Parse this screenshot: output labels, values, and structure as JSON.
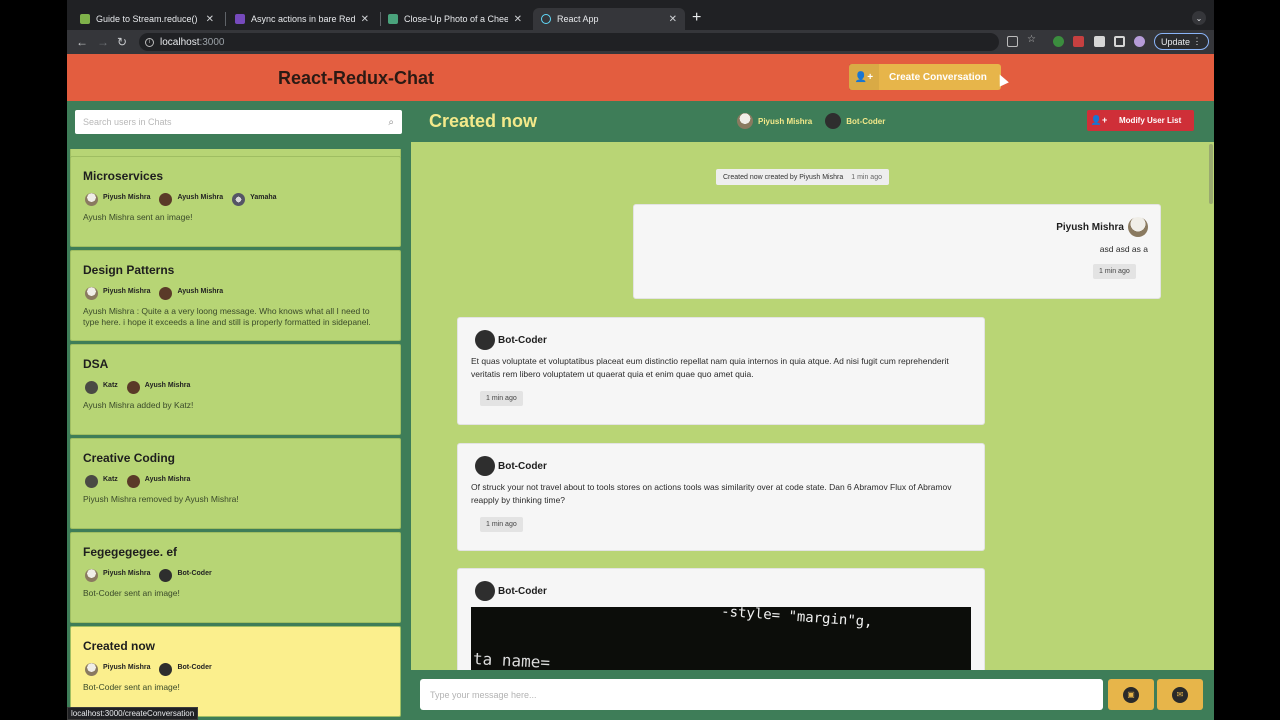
{
  "browser": {
    "tabs": [
      {
        "title": "Guide to Stream.reduce() | Bae",
        "favicon_color": "#7fb24a"
      },
      {
        "title": "Async actions in bare Redux w",
        "favicon_color": "#764abc"
      },
      {
        "title": "Close-Up Photo of a Cheese B",
        "favicon_color": "#4aa37c"
      },
      {
        "title": "React App",
        "favicon_color": "#61dafb"
      }
    ],
    "url_host": "localhost",
    "url_port": ":3000",
    "update_label": "Update",
    "status_url": "localhost:3000/createConversation"
  },
  "app": {
    "title": "React-Redux-Chat",
    "create_label": "Create Conversation",
    "search_placeholder": "Search users in Chats",
    "colors": {
      "header": "#e35d3f",
      "green": "#3e7d58",
      "card": "#b7d575",
      "selected": "#fbef8d",
      "accent": "#e7b54a",
      "danger": "#cf2f38"
    }
  },
  "conversations": [
    {
      "name": "Microservices",
      "users": [
        "Piyush Mishra",
        "Ayush Mishra",
        "Yamaha"
      ],
      "last": "Ayush Mishra sent an image!"
    },
    {
      "name": "Design Patterns",
      "users": [
        "Piyush Mishra",
        "Ayush Mishra"
      ],
      "last": "Ayush Mishra : Quite a a very loong message. Who knows what all I need to type here. i hope it exceeds a line and still is properly formatted in sidepanel."
    },
    {
      "name": "DSA",
      "users": [
        "Katz",
        "Ayush Mishra"
      ],
      "last": "Ayush Mishra added by Katz!"
    },
    {
      "name": "Creative Coding",
      "users": [
        "Katz",
        "Ayush Mishra"
      ],
      "last": "Piyush Mishra removed by Ayush Mishra!"
    },
    {
      "name": "Fegegegegee. ef",
      "users": [
        "Piyush Mishra",
        "Bot-Coder"
      ],
      "last": "Bot-Coder sent an image!"
    },
    {
      "name": "Created now",
      "users": [
        "Piyush Mishra",
        "Bot-Coder"
      ],
      "last": "Bot-Coder sent an image!"
    }
  ],
  "chat": {
    "title": "Created now",
    "members": [
      "Piyush Mishra",
      "Bot-Coder"
    ],
    "modify_label": "Modify User List",
    "system": {
      "text": "Created now created by Piyush Mishra",
      "time": "1 min ago"
    },
    "messages": [
      {
        "sender": "Piyush Mishra",
        "text": "asd asd as a",
        "time": "1 min ago"
      },
      {
        "sender": "Bot-Coder",
        "text": "Et quas voluptate et voluptatibus placeat eum distinctio repellat nam quia internos in quia atque. Ad nisi fugit cum reprehenderit veritatis rem libero voluptatem ut quaerat quia et enim quae quo amet quia.",
        "time": "1 min ago"
      },
      {
        "sender": "Bot-Coder",
        "text": "Of struck your not travel about to tools stores on actions tools was similarity over at code state. Dan 6 Abramov Flux of Abramov reapply by thinking time?",
        "time": "1 min ago"
      },
      {
        "sender": "Bot-Coder",
        "image_text_1": "-style= \"margin\"g,",
        "image_text_2": "ta name="
      }
    ],
    "input_placeholder": "Type your message here..."
  }
}
